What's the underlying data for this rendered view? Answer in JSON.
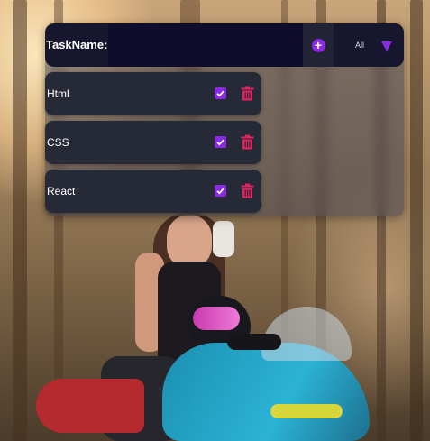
{
  "form": {
    "task_label": "TaskName:",
    "task_input_value": "",
    "add_icon": "plus-circle-icon",
    "filter_value": "All"
  },
  "todos": [
    {
      "text": "Html"
    },
    {
      "text": "CSS"
    },
    {
      "text": "React"
    }
  ],
  "colors": {
    "accent": "#8a2be2",
    "delete": "#e0245e",
    "form_background": "#16162e",
    "item_background": "#262a37"
  }
}
